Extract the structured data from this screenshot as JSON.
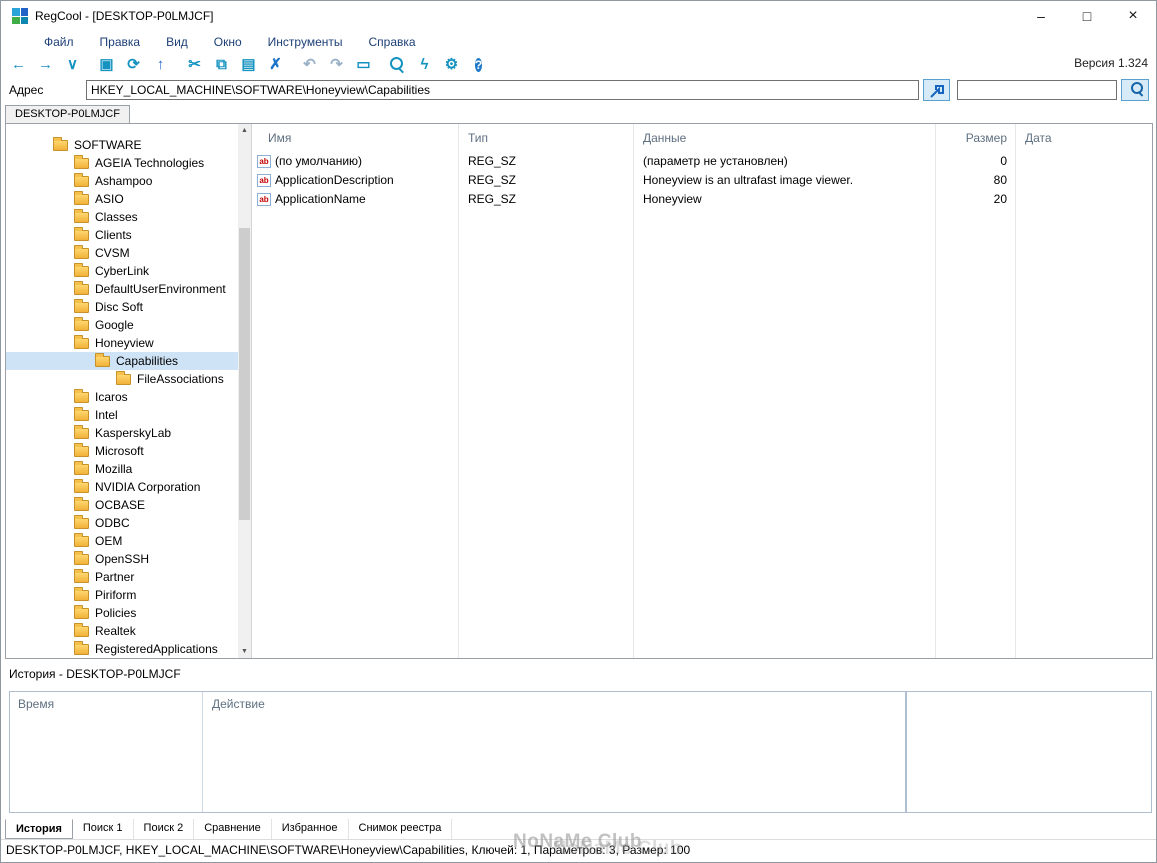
{
  "window": {
    "title": "RegCool - [DESKTOP-P0LMJCF]",
    "controls": [
      {
        "key": "minimize",
        "glyph": "–"
      },
      {
        "key": "maximize",
        "glyph": "□"
      },
      {
        "key": "close",
        "glyph": "×"
      }
    ]
  },
  "menu": [
    {
      "key": "file",
      "label": "Файл"
    },
    {
      "key": "edit",
      "label": "Правка"
    },
    {
      "key": "view",
      "label": "Вид"
    },
    {
      "key": "window",
      "label": "Окно"
    },
    {
      "key": "tools",
      "label": "Инструменты"
    },
    {
      "key": "help",
      "label": "Справка"
    }
  ],
  "toolbar": {
    "version_label": "Версия 1.324",
    "icons": [
      {
        "key": "back",
        "glyph": "←",
        "color": "#1593c0",
        "group": 0
      },
      {
        "key": "forward",
        "glyph": "→",
        "color": "#1593c0",
        "group": 0
      },
      {
        "key": "nav-dropdown",
        "glyph": "∨",
        "color": "#1593c0",
        "group": 0
      },
      {
        "key": "computer",
        "glyph": "▣",
        "color": "#1593c0",
        "group": 1
      },
      {
        "key": "refresh",
        "glyph": "⟳",
        "color": "#1593c0",
        "group": 1
      },
      {
        "key": "up",
        "glyph": "↑",
        "color": "#2f6fd0",
        "group": 1
      },
      {
        "key": "cut",
        "glyph": "✂",
        "color": "#1593c0",
        "group": 2
      },
      {
        "key": "copy",
        "glyph": "⧉",
        "color": "#1593c0",
        "group": 2
      },
      {
        "key": "paste",
        "glyph": "▤",
        "color": "#1593c0",
        "group": 2
      },
      {
        "key": "delete",
        "glyph": "✗",
        "color": "#1c74c8",
        "group": 2
      },
      {
        "key": "undo",
        "glyph": "↶",
        "color": "#9ab2c8",
        "group": 3
      },
      {
        "key": "redo",
        "glyph": "↷",
        "color": "#9ab2c8",
        "group": 3
      },
      {
        "key": "rename",
        "glyph": "▭",
        "color": "#1593c0",
        "group": 3
      },
      {
        "key": "search",
        "shape": "magnifier",
        "color": "#1593c0",
        "group": 4
      },
      {
        "key": "flash",
        "glyph": "ϟ",
        "color": "#1593c0",
        "group": 4
      },
      {
        "key": "settings",
        "glyph": "⚙",
        "color": "#1593c0",
        "group": 4
      },
      {
        "key": "help",
        "shape": "help-circle",
        "color": "#1e78c8",
        "group": 4
      }
    ]
  },
  "address": {
    "label": "Адрес",
    "value": "HKEY_LOCAL_MACHINE\\SOFTWARE\\Honeyview\\Capabilities",
    "search_value": ""
  },
  "server_tab": "DESKTOP-P0LMJCF",
  "tree": {
    "items": [
      {
        "label": "SOFTWARE",
        "level": 0,
        "open": true
      },
      {
        "label": "AGEIA Technologies",
        "level": 1
      },
      {
        "label": "Ashampoo",
        "level": 1
      },
      {
        "label": "ASIO",
        "level": 1
      },
      {
        "label": "Classes",
        "level": 1
      },
      {
        "label": "Clients",
        "level": 1
      },
      {
        "label": "CVSM",
        "level": 1
      },
      {
        "label": "CyberLink",
        "level": 1
      },
      {
        "label": "DefaultUserEnvironment",
        "level": 1
      },
      {
        "label": "Disc Soft",
        "level": 1
      },
      {
        "label": "Google",
        "level": 1
      },
      {
        "label": "Honeyview",
        "level": 1,
        "open": true
      },
      {
        "label": "Capabilities",
        "level": 2,
        "selected": true,
        "open": true
      },
      {
        "label": "FileAssociations",
        "level": 3
      },
      {
        "label": "Icaros",
        "level": 1
      },
      {
        "label": "Intel",
        "level": 1
      },
      {
        "label": "KasperskyLab",
        "level": 1
      },
      {
        "label": "Microsoft",
        "level": 1
      },
      {
        "label": "Mozilla",
        "level": 1
      },
      {
        "label": "NVIDIA Corporation",
        "level": 1
      },
      {
        "label": "OCBASE",
        "level": 1
      },
      {
        "label": "ODBC",
        "level": 1
      },
      {
        "label": "OEM",
        "level": 1
      },
      {
        "label": "OpenSSH",
        "level": 1
      },
      {
        "label": "Partner",
        "level": 1
      },
      {
        "label": "Piriform",
        "level": 1
      },
      {
        "label": "Policies",
        "level": 1
      },
      {
        "label": "Realtek",
        "level": 1
      },
      {
        "label": "RegisteredApplications",
        "level": 1
      }
    ]
  },
  "value_list": {
    "columns": [
      "Имя",
      "Тип",
      "Данные",
      "Размер",
      "Дата"
    ],
    "rows": [
      {
        "name": "(по умолчанию)",
        "type": "REG_SZ",
        "data": "(параметр не установлен)",
        "size": "0",
        "date": ""
      },
      {
        "name": "ApplicationDescription",
        "type": "REG_SZ",
        "data": "Honeyview is an ultrafast image viewer.",
        "size": "80",
        "date": ""
      },
      {
        "name": "ApplicationName",
        "type": "REG_SZ",
        "data": "Honeyview",
        "size": "20",
        "date": ""
      }
    ]
  },
  "history_panel": {
    "title": "История - DESKTOP-P0LMJCF",
    "columns": [
      "Время",
      "Действие"
    ]
  },
  "bottom_tabs": [
    {
      "key": "history",
      "label": "История",
      "active": true
    },
    {
      "key": "search-1",
      "label": "Поиск 1"
    },
    {
      "key": "search-2",
      "label": "Поиск 2"
    },
    {
      "key": "compare",
      "label": "Сравнение"
    },
    {
      "key": "favorites",
      "label": "Избранное"
    },
    {
      "key": "registry-snapshot",
      "label": "Снимок реестра"
    }
  ],
  "status_bar": {
    "text": "DESKTOP-P0LMJCF, HKEY_LOCAL_MACHINE\\SOFTWARE\\Honeyview\\Capabilities, Ключей: 1, Параметров: 3, Размер: 100"
  },
  "watermark": "NoNaMe Club"
}
